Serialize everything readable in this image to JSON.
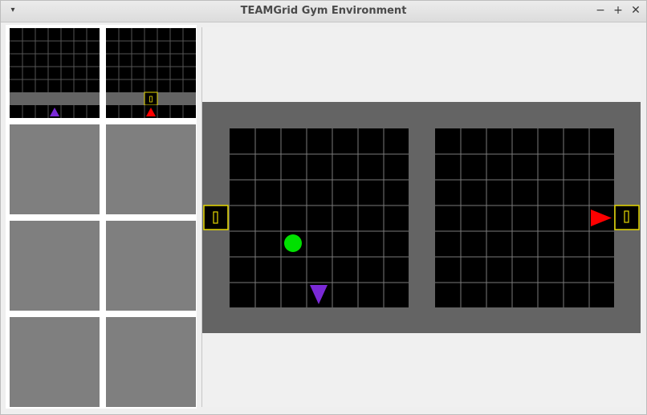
{
  "window": {
    "title": "TEAMGrid Gym Environment",
    "controls": {
      "menu": "▾",
      "minimize": "−",
      "maximize": "+",
      "close": "✕"
    }
  },
  "thumbnails": [
    {
      "type": "view",
      "agent": {
        "color": "#7a29d6",
        "direction": "up"
      },
      "door": false
    },
    {
      "type": "view",
      "agent": {
        "color": "#ff0000",
        "direction": "up"
      },
      "door": true
    },
    {
      "type": "empty"
    },
    {
      "type": "empty"
    },
    {
      "type": "empty"
    },
    {
      "type": "empty"
    },
    {
      "type": "empty"
    },
    {
      "type": "empty"
    }
  ],
  "colors": {
    "background_wall": "#646464",
    "grid_floor": "#000000",
    "grid_line": "#7a7a7a",
    "door": "#e6d800",
    "ball": "#00e000",
    "agent_purple": "#7a29d6",
    "agent_red": "#ff0000",
    "empty_tile": "#7f7f7f"
  },
  "main_view": {
    "rooms": [
      {
        "name": "left-room",
        "cols": 7,
        "rows": 7
      },
      {
        "name": "right-room",
        "cols": 7,
        "rows": 7
      }
    ],
    "objects": [
      {
        "kind": "door",
        "room": "left-wall",
        "color": "#e6d800",
        "icon": "door-icon"
      },
      {
        "kind": "door",
        "room": "right-wall",
        "color": "#e6d800",
        "icon": "door-icon"
      },
      {
        "kind": "ball",
        "color": "#00e000",
        "icon": "ball-icon"
      },
      {
        "kind": "agent",
        "color": "#7a29d6",
        "direction": "down",
        "icon": "agent-triangle-icon"
      },
      {
        "kind": "agent",
        "color": "#ff0000",
        "direction": "right",
        "icon": "agent-triangle-icon"
      }
    ]
  }
}
